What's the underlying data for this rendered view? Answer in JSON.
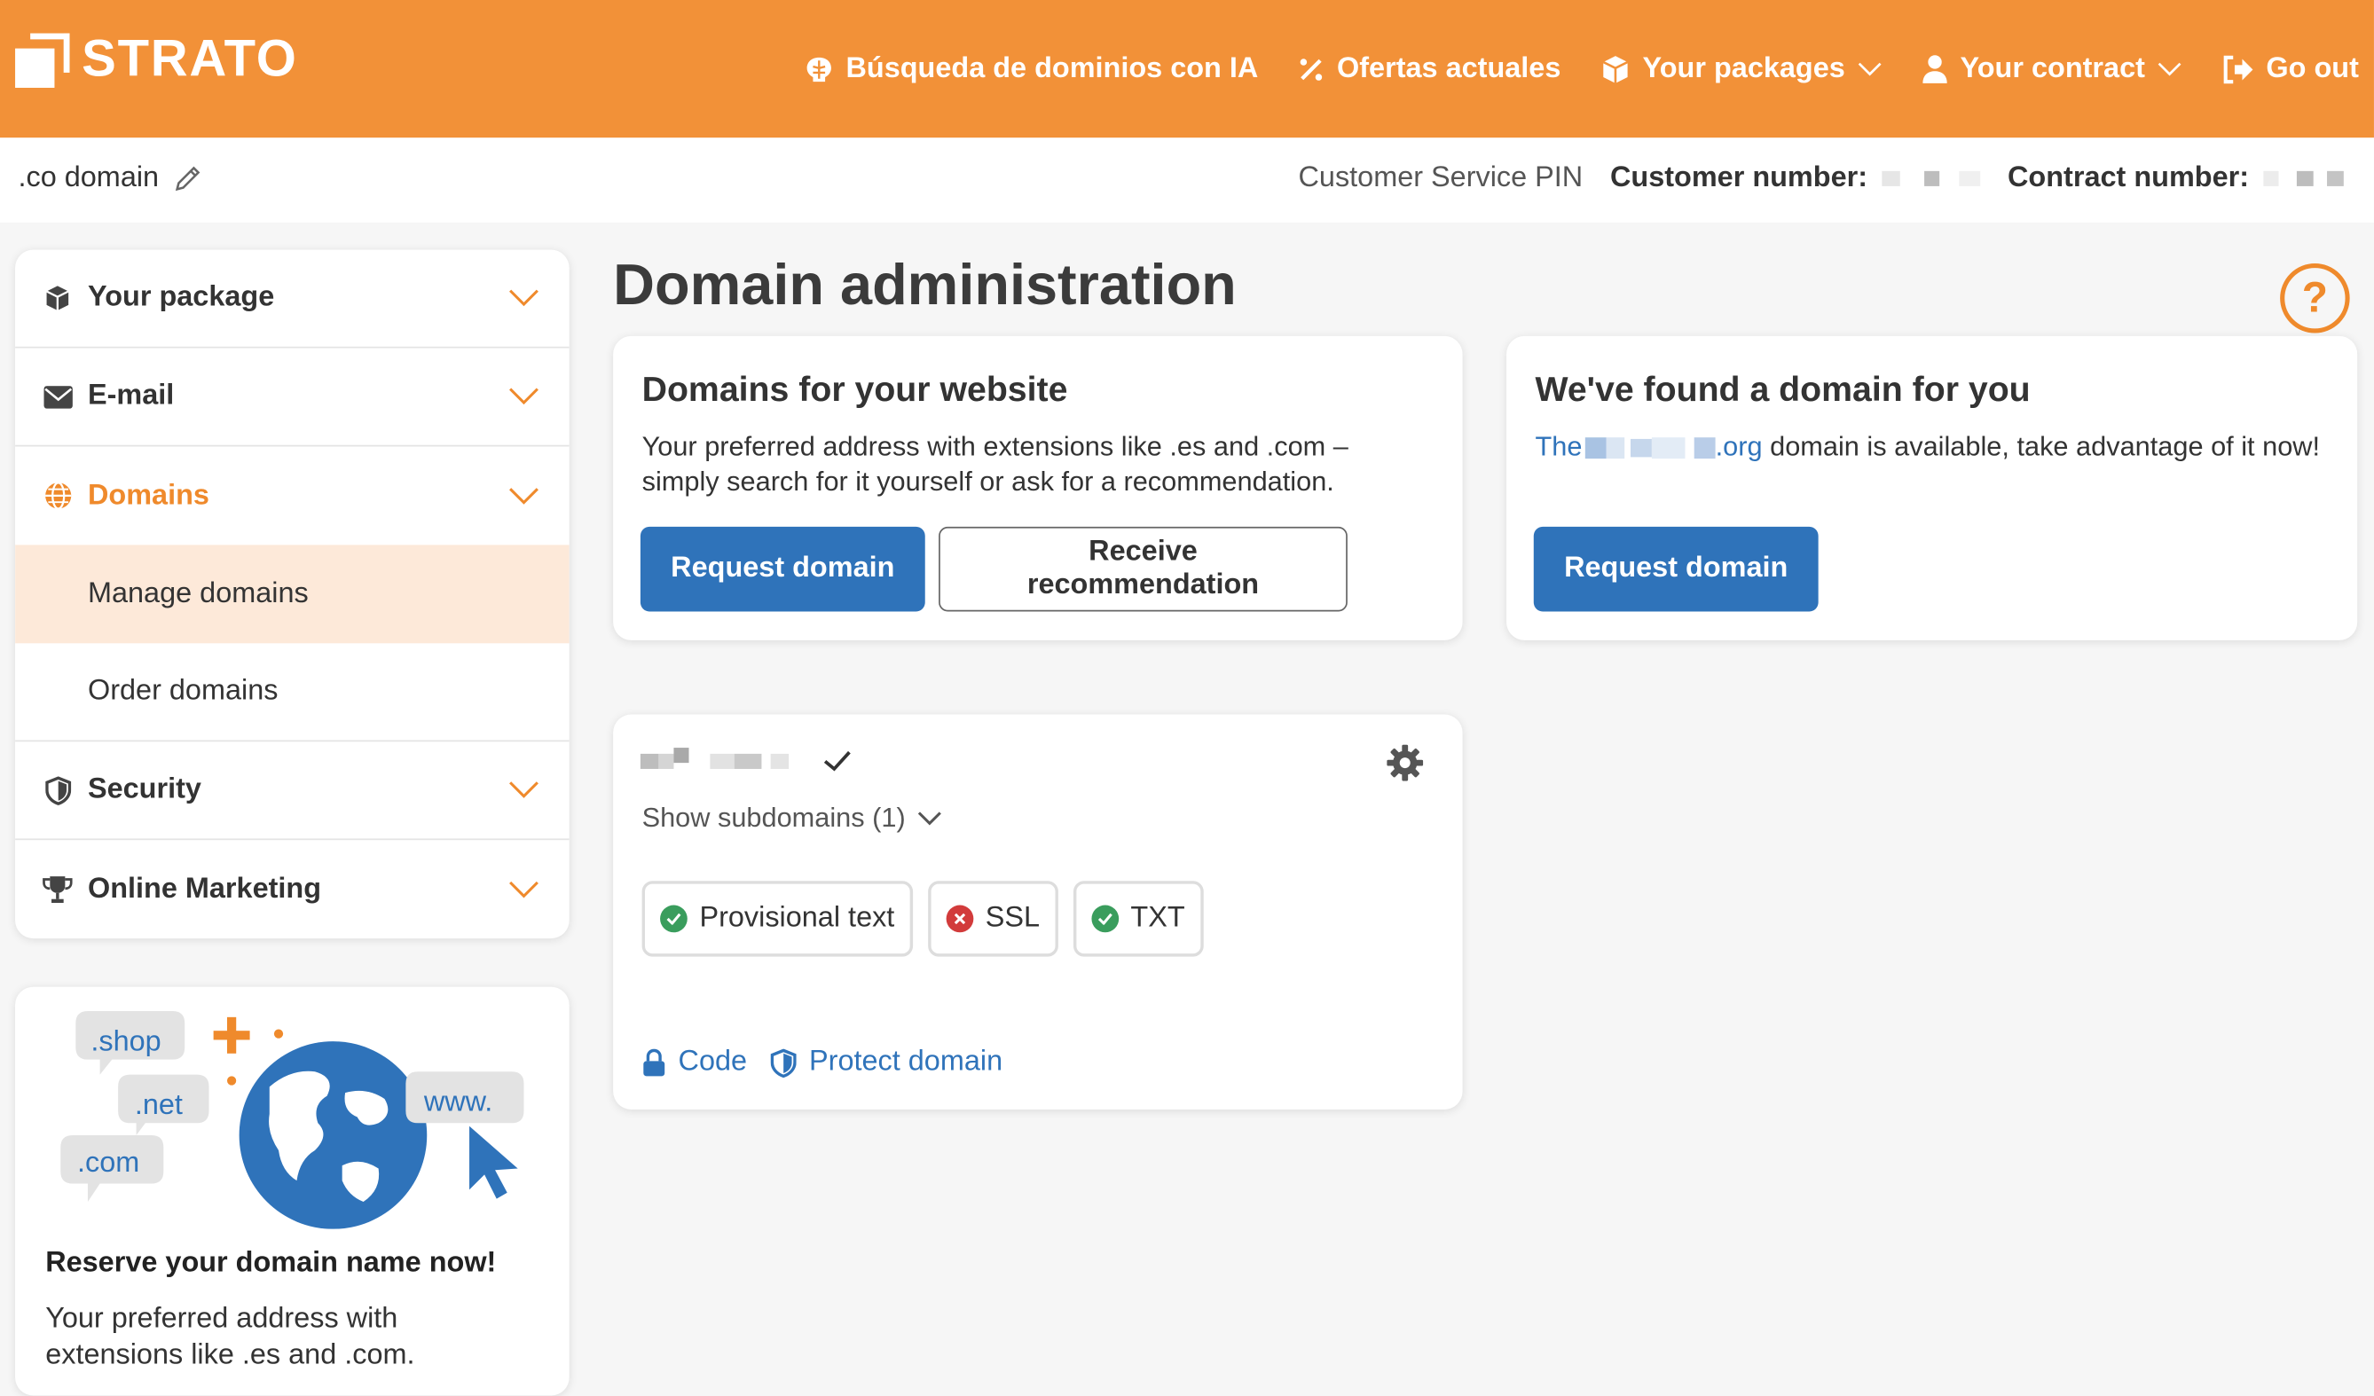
{
  "header": {
    "logo_text": "STRATO",
    "nav": [
      {
        "label": "Búsqueda de dominios con IA",
        "icon": "brain-icon"
      },
      {
        "label": "Ofertas actuales",
        "icon": "percent-icon"
      },
      {
        "label": "Your packages",
        "icon": "package-icon"
      },
      {
        "label": "Your contract",
        "icon": "user-icon"
      },
      {
        "label": "Go out",
        "icon": "logout-icon"
      }
    ]
  },
  "subbar": {
    "package_name": ".co domain",
    "customer_service_pin": "Customer Service PIN",
    "customer_number_label": "Customer number:",
    "contract_number_label": "Contract number:"
  },
  "sidebar": {
    "items": [
      {
        "label": "Your package",
        "icon": "package-icon"
      },
      {
        "label": "E-mail",
        "icon": "envelope-icon"
      },
      {
        "label": "Domains",
        "icon": "globe-icon"
      },
      {
        "label": "Security",
        "icon": "shield-icon"
      },
      {
        "label": "Online Marketing",
        "icon": "trophy-icon"
      }
    ],
    "domains_sub": [
      "Manage domains",
      "Order domains"
    ]
  },
  "promo": {
    "tags": [
      ".shop",
      ".net",
      ".com",
      "www."
    ],
    "title": "Reserve your domain name now!",
    "text": "Your preferred address with extensions like .es and .com."
  },
  "main": {
    "title": "Domain administration",
    "help_label": "?",
    "card_website": {
      "title": "Domains for your website",
      "text": "Your preferred address with extensions like .es and .com – simply search for it yourself or ask for a recommendation.",
      "primary_button": "Request domain",
      "secondary_button": "Receive recommendation"
    },
    "card_found": {
      "title": "We've found a domain for you",
      "domain_prefix": "The",
      "domain_suffix": ".org",
      "text_rest": " domain is available, take advantage of it now!",
      "button": "Request domain"
    },
    "domain_card": {
      "show_subdomains": "Show subdomains (1)",
      "chips": [
        {
          "label": "Provisional text",
          "status": "ok"
        },
        {
          "label": "SSL",
          "status": "error"
        },
        {
          "label": "TXT",
          "status": "ok"
        }
      ],
      "links": [
        {
          "label": "Code",
          "icon": "lock-icon"
        },
        {
          "label": "Protect domain",
          "icon": "shield-icon"
        }
      ]
    }
  },
  "colors": {
    "brand_orange": "#f29138",
    "accent_orange": "#ef8a2c",
    "primary_blue": "#2f73ba",
    "ok_green": "#3a9d5d",
    "error_red": "#d23b3b"
  }
}
